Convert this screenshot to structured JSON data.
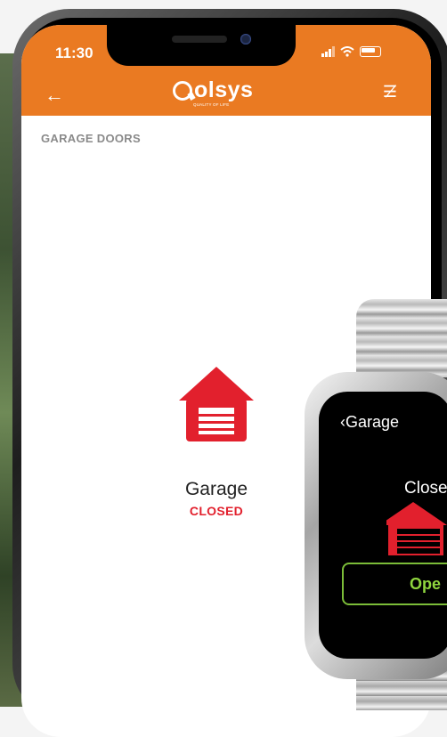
{
  "status_bar": {
    "time": "11:30"
  },
  "header": {
    "brand": "olsys",
    "tagline": "QUALITY OF LIFE"
  },
  "page": {
    "section_title": "GARAGE DOORS"
  },
  "device": {
    "name": "Garage",
    "state": "CLOSED",
    "state_color": "#e2202d"
  },
  "watch": {
    "back_label": "Garage",
    "status": "Close",
    "button_label": "Ope"
  },
  "colors": {
    "accent": "#ea7a22",
    "watch_button": "#7bbc38"
  },
  "icons": {
    "back": "back-arrow-icon",
    "menu": "checklist-icon",
    "device": "garage-icon"
  }
}
